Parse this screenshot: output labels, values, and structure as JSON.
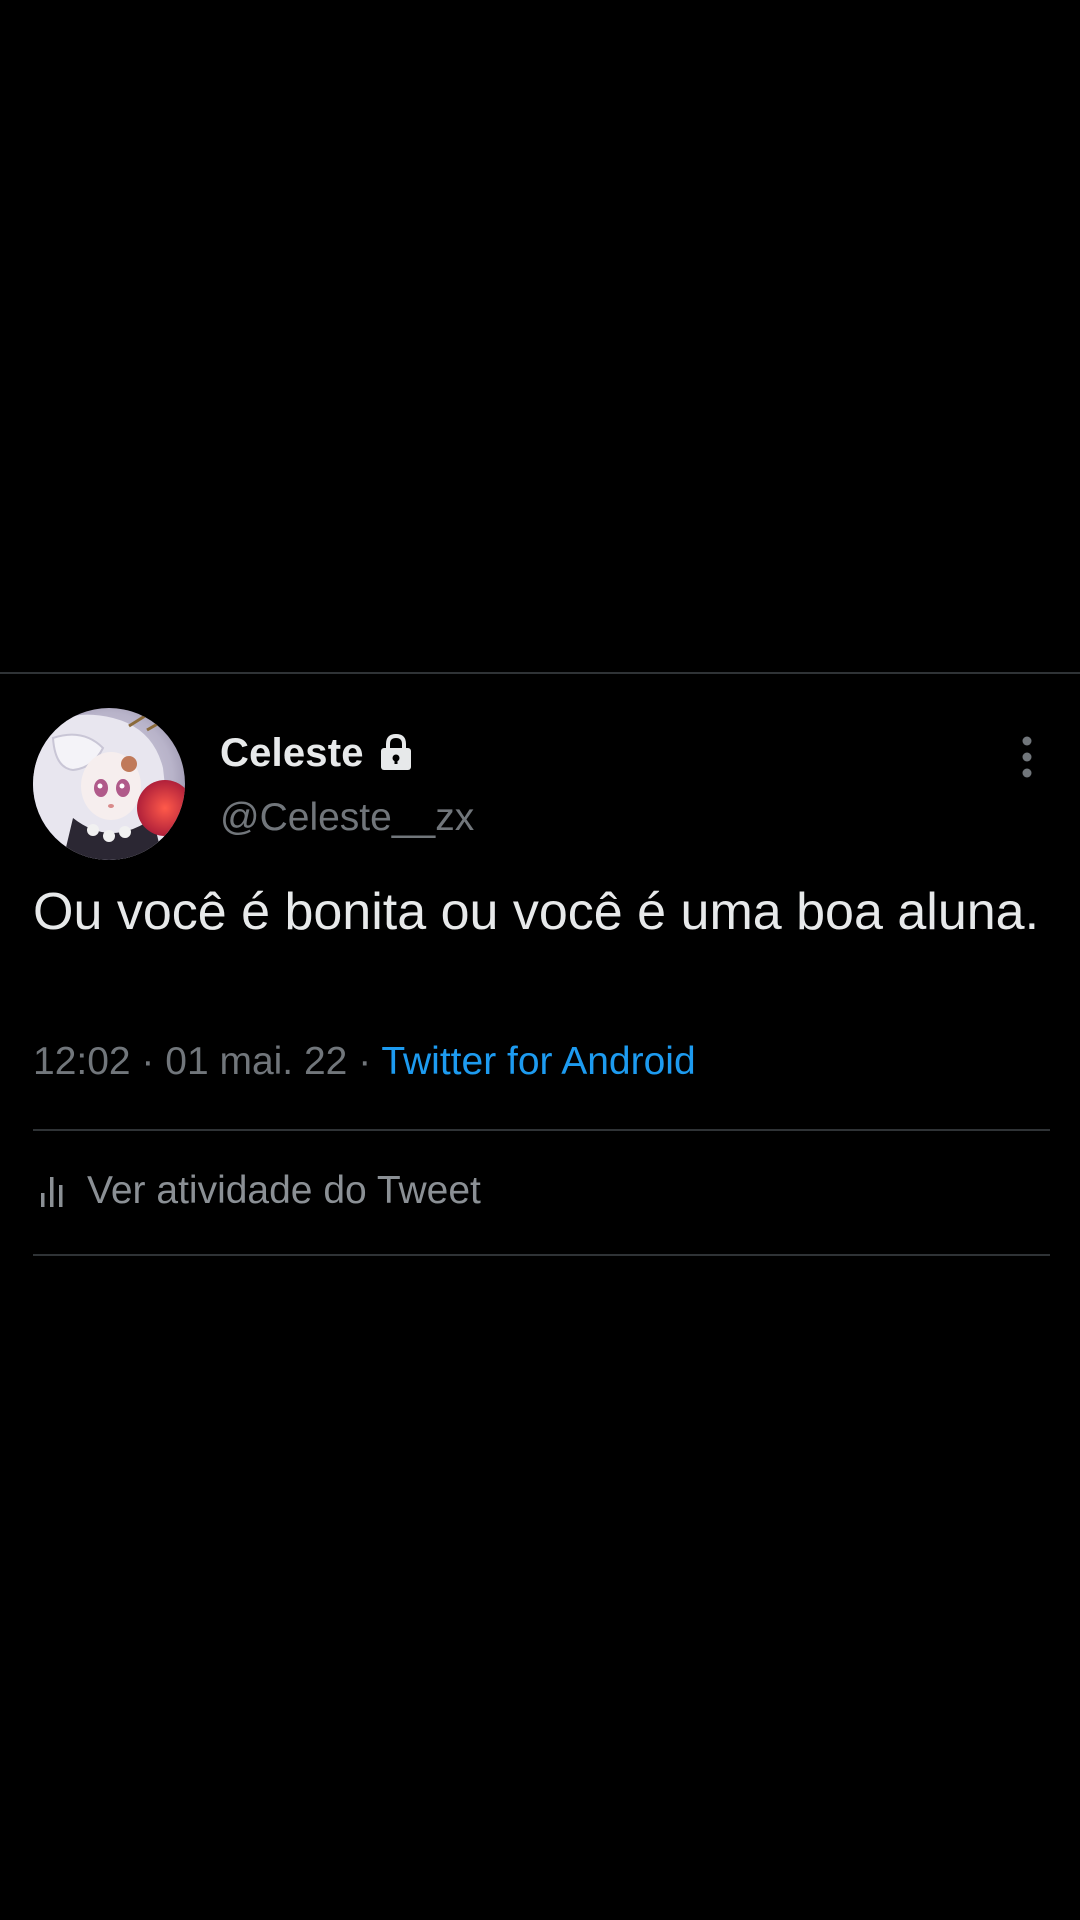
{
  "tweet": {
    "author": {
      "display_name": "Celeste",
      "handle": "@Celeste__zx",
      "protected_icon": "lock-icon",
      "avatar": "avatar-anime-girl"
    },
    "text": "Ou você é bonita ou você é uma boa aluna.",
    "timestamp": "12:02 · 01 mai. 22 · ",
    "source": "Twitter for Android",
    "more_icon": "more-vertical-icon",
    "activity": {
      "icon": "bar-chart-icon",
      "label": "Ver atividade do Tweet"
    }
  },
  "colors": {
    "background": "#000000",
    "text_primary": "#e7e9ea",
    "text_secondary": "#71767b",
    "accent": "#1d9bf0",
    "divider": "#2f3336"
  }
}
